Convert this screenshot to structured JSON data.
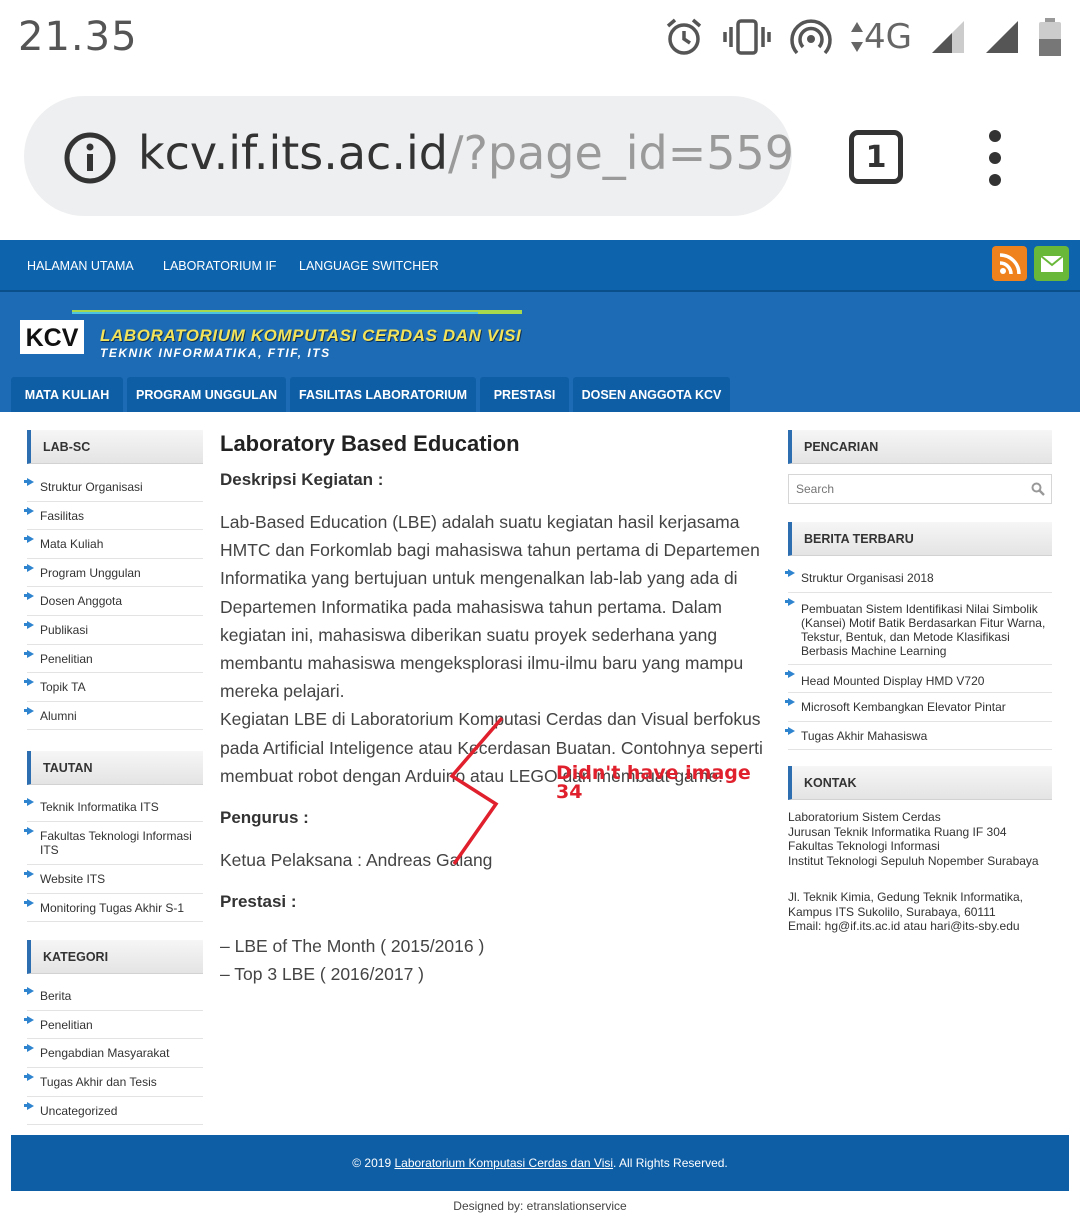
{
  "statusbar": {
    "time": "21.35",
    "network": "4G",
    "icons": [
      "alarm-icon",
      "vibrate-icon",
      "hotspot-icon",
      "data-arrows-icon",
      "signal-icon",
      "signal-icon",
      "battery-icon"
    ]
  },
  "browser": {
    "url_host": "kcv.if.its.ac.id",
    "url_path": "/?page_id=559",
    "tab_count": "1"
  },
  "topnav": {
    "items": [
      "HALAMAN UTAMA",
      "LABORATORIUM IF",
      "LANGUAGE SWITCHER"
    ]
  },
  "logo": {
    "mark": "KCV",
    "title": "LABORATORIUM KOMPUTASI CERDAS DAN VISI",
    "subtitle": "TEKNIK INFORMATIKA, FTIF, ITS"
  },
  "mainnav": {
    "items": [
      "MATA KULIAH",
      "PROGRAM UNGGULAN",
      "FASILITAS LABORATORIUM",
      "PRESTASI",
      "DOSEN ANGGOTA KCV"
    ]
  },
  "sidebar_left": {
    "labsc": {
      "title": "LAB-SC",
      "items": [
        "Struktur Organisasi",
        "Fasilitas",
        "Mata Kuliah",
        "Program Unggulan",
        "Dosen Anggota",
        "Publikasi",
        "Penelitian",
        "Topik TA",
        "Alumni"
      ]
    },
    "tautan": {
      "title": "TAUTAN",
      "items": [
        "Teknik Informatika ITS",
        "Fakultas Teknologi Informasi ITS",
        "Website ITS",
        "Monitoring Tugas Akhir S-1"
      ]
    },
    "kategori": {
      "title": "KATEGORI",
      "items": [
        "Berita",
        "Penelitian",
        "Pengabdian Masyarakat",
        "Tugas Akhir dan Tesis",
        "Uncategorized"
      ]
    }
  },
  "article": {
    "title": "Laboratory Based Education",
    "desc_heading": "Deskripsi Kegiatan :",
    "paragraph1": "Lab-Based Education (LBE) adalah suatu kegiatan hasil kerjasama HMTC dan Forkomlab bagi mahasiswa tahun pertama di Departemen Informatika yang bertujuan untuk mengenalkan lab-lab yang ada di Departemen Informatika pada mahasiswa tahun pertama. Dalam kegiatan ini, mahasiswa diberikan suatu proyek sederhana yang membantu mahasiswa mengeksplorasi ilmu-ilmu baru yang mampu mereka pelajari.",
    "paragraph2": "Kegiatan LBE di Laboratorium Komputasi Cerdas dan Visual berfokus pada Artificial Inteligence atau Kecerdasan Buatan. Contohnya seperti membuat robot dengan Arduino atau LEGO dan membuat game.",
    "pengurus_heading": "Pengurus :",
    "ketua": "Ketua Pelaksana : Andreas Galang",
    "prestasi_heading": "Prestasi :",
    "prestasi_items": [
      "– LBE of The Month ( 2015/2016 )",
      "– Top 3 LBE ( 2016/2017 )"
    ]
  },
  "annotation": {
    "line1": "Didn't have image",
    "line2": "34",
    "color": "#e0202c"
  },
  "sidebar_right": {
    "pencarian": {
      "title": "PENCARIAN",
      "placeholder": "Search"
    },
    "berita": {
      "title": "BERITA TERBARU",
      "items": [
        "Struktur Organisasi 2018",
        "Pembuatan Sistem Identifikasi Nilai Simbolik (Kansei) Motif Batik Berdasarkan Fitur Warna, Tekstur, Bentuk, dan Metode Klasifikasi Berbasis Machine Learning",
        "Head Mounted Display HMD V720",
        "Microsoft Kembangkan Elevator Pintar",
        "Tugas Akhir Mahasiswa"
      ]
    },
    "kontak": {
      "title": "KONTAK",
      "lines1": [
        "Laboratorium Sistem Cerdas",
        "Jurusan Teknik Informatika Ruang IF 304",
        "Fakultas Teknologi Informasi",
        "Institut Teknologi Sepuluh Nopember Surabaya"
      ],
      "lines2": [
        "Jl. Teknik Kimia, Gedung Teknik Informatika,",
        "Kampus ITS Sukolilo, Surabaya, 60111",
        "Email: hg@if.its.ac.id atau hari@its-sby.edu"
      ]
    }
  },
  "footer": {
    "copy_prefix": "© 2019 ",
    "copy_link": "Laboratorium Komputasi Cerdas dan Visi",
    "copy_suffix": ". All Rights Reserved.",
    "designed": "Designed by: etranslationservice"
  },
  "colors": {
    "brand_blue": "#0e63ad",
    "banner_blue": "#1d6bb4",
    "rss_orange": "#f0821e",
    "mail_green": "#6ab83a",
    "logo_yellow": "#f2e35a"
  }
}
